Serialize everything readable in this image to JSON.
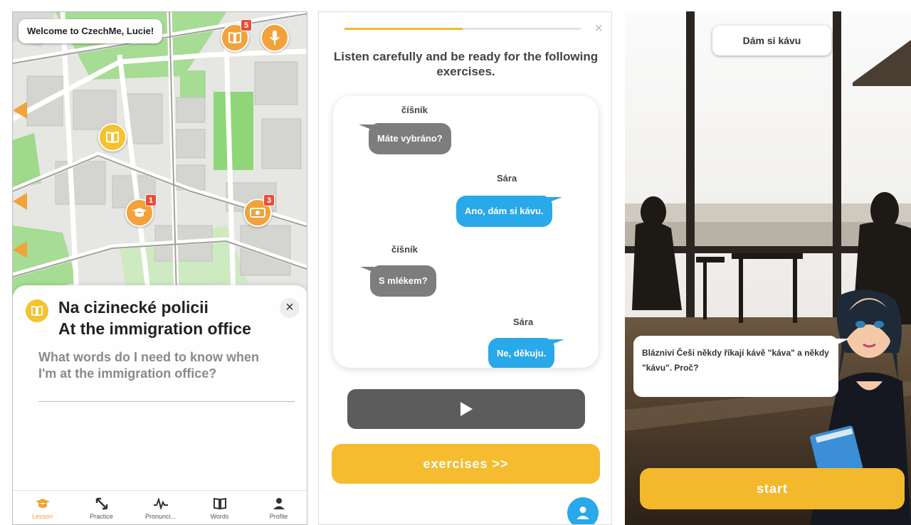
{
  "colors": {
    "accent_orange": "#f3a23a",
    "accent_yellow": "#f5bc2f",
    "badge_red": "#e84d3c",
    "bubble_blue": "#29a8ea",
    "bubble_gray": "#7d7d7d"
  },
  "map_screen": {
    "welcome": "Welcome to CzechMe, Lucie!",
    "pins": [
      {
        "icon": "book-icon",
        "badge": "5"
      },
      {
        "icon": "microphone-icon",
        "badge": ""
      },
      {
        "icon": "book-icon",
        "badge": ""
      },
      {
        "icon": "graduation-cap-icon",
        "badge": "1"
      },
      {
        "icon": "money-icon",
        "badge": "3"
      }
    ],
    "lesson": {
      "title_cz": "Na cizinecké policii",
      "title_en": "At the immigration office",
      "description": "What words do I need to know when I'm at the immigration office?",
      "close": "×"
    },
    "nav": [
      {
        "label": "Lesson",
        "icon": "graduation-cap-icon",
        "active": true
      },
      {
        "label": "Practice",
        "icon": "arrows-icon",
        "active": false
      },
      {
        "label": "Pronunci...",
        "icon": "waveform-icon",
        "active": false
      },
      {
        "label": "Words",
        "icon": "book-icon",
        "active": false
      },
      {
        "label": "Profile",
        "icon": "person-icon",
        "active": false
      }
    ]
  },
  "dialog_screen": {
    "progress": 0.5,
    "close": "×",
    "instruction": "Listen carefully and be ready for the following exercises.",
    "messages": [
      {
        "speaker": "číšník",
        "text": "Máte vybráno?",
        "side": "left"
      },
      {
        "speaker": "Sára",
        "text": "Ano, dám si kávu.",
        "side": "right"
      },
      {
        "speaker": "číšník",
        "text": "S mlékem?",
        "side": "left"
      },
      {
        "speaker": "Sára",
        "text": "Ne, děkuju.",
        "side": "right"
      }
    ],
    "play_icon": "play-icon",
    "exercises_button": "exercises >>",
    "profile_icon": "person-icon"
  },
  "scene_screen": {
    "phrase": "Dám si kávu",
    "speech": "Blázniví Češi někdy říkají kávě \"káva\" a někdy \"kávu\". Proč?",
    "start_button": "start"
  }
}
